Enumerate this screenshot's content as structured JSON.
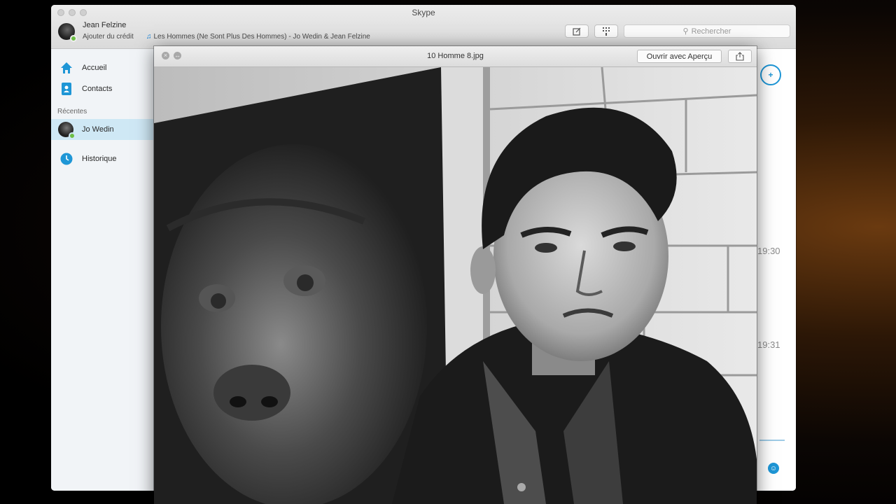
{
  "skype": {
    "window_title": "Skype",
    "user": {
      "name": "Jean Felzine",
      "credit": "Ajouter du crédit",
      "mood": "Les Hommes (Ne Sont Plus Des Hommes) - Jo Wedin & Jean Felzine"
    },
    "search": {
      "placeholder": "Rechercher"
    },
    "nav": {
      "home": "Accueil",
      "contacts": "Contacts",
      "recent_header": "Récentes",
      "recent_contact": "Jo Wedin",
      "history": "Historique"
    },
    "times": [
      "19:30",
      "19:31"
    ]
  },
  "quicklook": {
    "title": "10 Homme 8.jpg",
    "open_button": "Ouvrir avec Aperçu"
  },
  "colors": {
    "skype_blue": "#1e96d6",
    "presence_online": "#6cbe45",
    "sidebar_active": "#cfe8f5"
  }
}
